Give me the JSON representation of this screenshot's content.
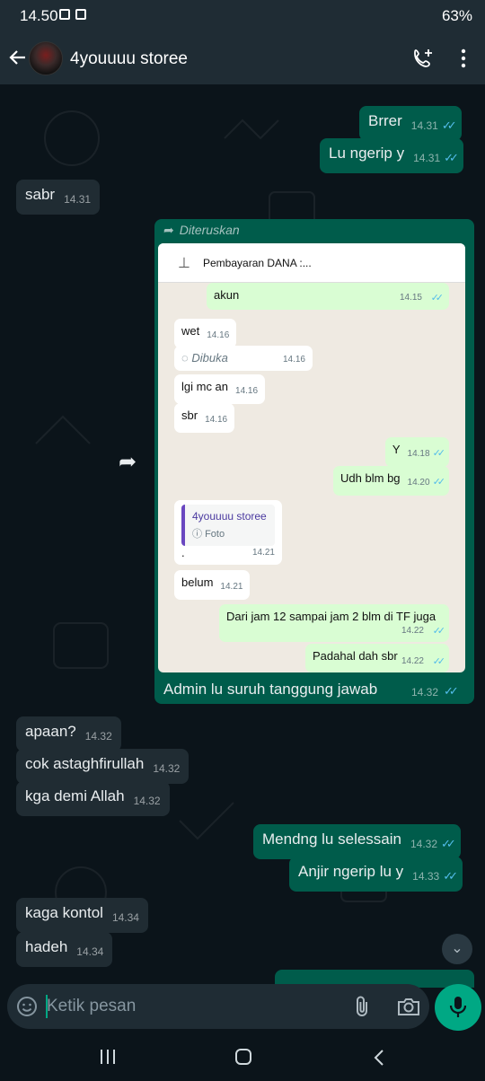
{
  "status_bar": {
    "time": "14.50",
    "battery": "63%"
  },
  "header": {
    "contact_name": "4youuuu storee"
  },
  "messages_top": [
    {
      "text": "Brrer",
      "time": "14.31",
      "dir": "out"
    },
    {
      "text": "Lu ngerip y",
      "time": "14.31",
      "dir": "out"
    },
    {
      "text": "sabr",
      "time": "14.31",
      "dir": "in"
    }
  ],
  "forwarded": {
    "label": "Diteruskan",
    "caption": "Admin lu suruh tanggung jawab",
    "time": "14.32",
    "screenshot": {
      "pinned_title": "Pembayaran DANA :...",
      "messages": [
        {
          "text": "akun",
          "time": "14.15",
          "dir": "out"
        },
        {
          "text": "wet",
          "time": "14.16",
          "dir": "in"
        },
        {
          "text": "Dibuka",
          "time": "14.16",
          "dir": "in"
        },
        {
          "text": "lgi mc an",
          "time": "14.16",
          "dir": "in"
        },
        {
          "text": "sbr",
          "time": "14.16",
          "dir": "in"
        },
        {
          "text": "Y",
          "time": "14.18",
          "dir": "out"
        },
        {
          "text": "Udh blm bg",
          "time": "14.20",
          "dir": "out"
        },
        {
          "text": ".",
          "time": "14.21",
          "dir": "in",
          "quote_name": "4youuuu storee",
          "quote_body": "Foto"
        },
        {
          "text": "belum",
          "time": "14.21",
          "dir": "in"
        },
        {
          "text": "Dari jam 12 sampai jam 2 blm di TF juga",
          "time": "14.22",
          "dir": "out"
        },
        {
          "text": "Padahal dah sbr",
          "time": "14.22",
          "dir": "out"
        }
      ]
    }
  },
  "messages_bottom": [
    {
      "text": "apaan?",
      "time": "14.32",
      "dir": "in"
    },
    {
      "text": "cok astaghfirullah",
      "time": "14.32",
      "dir": "in"
    },
    {
      "text": "kga demi Allah",
      "time": "14.32",
      "dir": "in"
    },
    {
      "text": "Mendng lu selessain",
      "time": "14.32",
      "dir": "out"
    },
    {
      "text": "Anjir ngerip lu y",
      "time": "14.33",
      "dir": "out"
    },
    {
      "text": "kaga kontol",
      "time": "14.34",
      "dir": "in"
    },
    {
      "text": "hadeh",
      "time": "14.34",
      "dir": "in"
    }
  ],
  "input": {
    "placeholder": "Ketik pesan"
  },
  "colors": {
    "incoming": "#202c33",
    "outgoing": "#005c4b",
    "accent": "#00a884",
    "read_ticks": "#53bdeb"
  }
}
